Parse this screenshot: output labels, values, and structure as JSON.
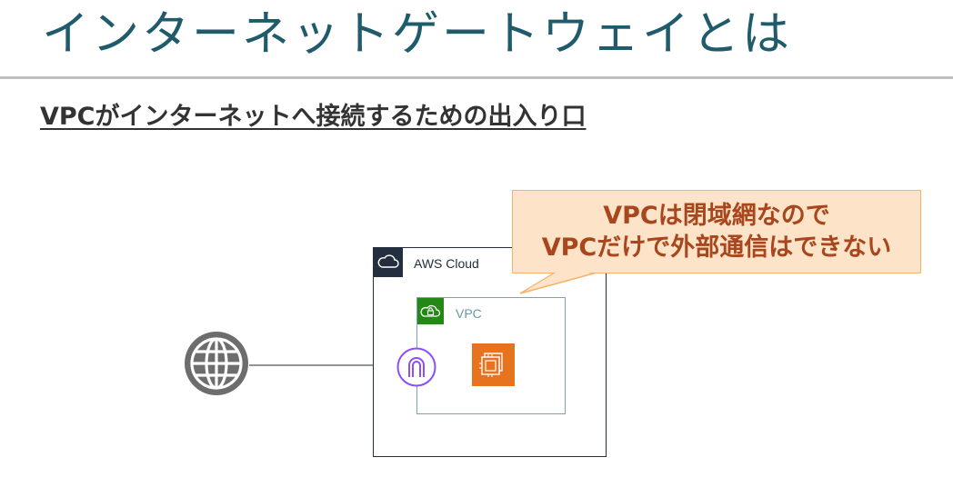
{
  "slide": {
    "title": "インターネットゲートウェイとは",
    "subtitle": "VPCがインターネットへ接続するための出入り口"
  },
  "diagram": {
    "aws_cloud_label": "AWS Cloud",
    "vpc_label": "VPC",
    "callout_line1": "VPCは閉域網なので",
    "callout_line2": "VPCだけで外部通信はできない"
  },
  "colors": {
    "title": "#1f5b6b",
    "aws_dark": "#232f3e",
    "vpc_green": "#248814",
    "ec2_orange": "#e8731e",
    "gateway_purple": "#8c4fff",
    "callout_fill": "#fde4c8",
    "callout_text": "#a8461d"
  }
}
